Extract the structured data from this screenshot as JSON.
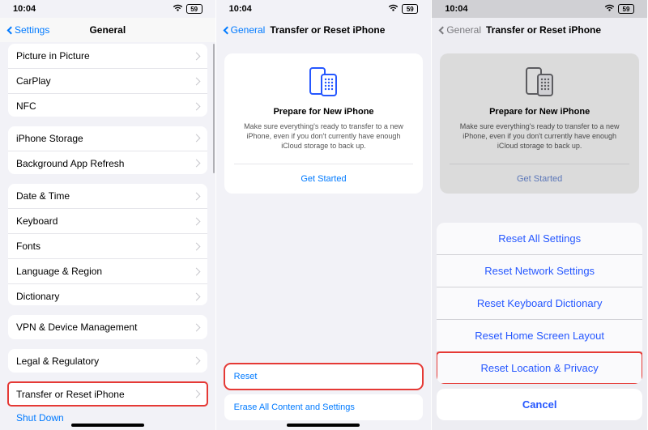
{
  "status": {
    "time": "10:04",
    "battery": "59"
  },
  "panel1": {
    "back": "Settings",
    "title": "General",
    "groups": [
      [
        "Picture in Picture",
        "CarPlay",
        "NFC"
      ],
      [
        "iPhone Storage",
        "Background App Refresh"
      ],
      [
        "Date & Time",
        "Keyboard",
        "Fonts",
        "Language & Region",
        "Dictionary"
      ],
      [
        "VPN & Device Management"
      ],
      [
        "Legal & Regulatory"
      ],
      [
        "Transfer or Reset iPhone"
      ]
    ],
    "shutdown": "Shut Down"
  },
  "panel2": {
    "back": "General",
    "title": "Transfer or Reset iPhone",
    "card": {
      "heading": "Prepare for New iPhone",
      "body": "Make sure everything's ready to transfer to a new iPhone, even if you don't currently have enough iCloud storage to back up.",
      "cta": "Get Started"
    },
    "reset": "Reset",
    "erase": "Erase All Content and Settings"
  },
  "panel3": {
    "back": "General",
    "title": "Transfer or Reset iPhone",
    "sheet": {
      "items": [
        "Reset All Settings",
        "Reset Network Settings",
        "Reset Keyboard Dictionary",
        "Reset Home Screen Layout",
        "Reset Location & Privacy"
      ],
      "cancel": "Cancel"
    }
  }
}
